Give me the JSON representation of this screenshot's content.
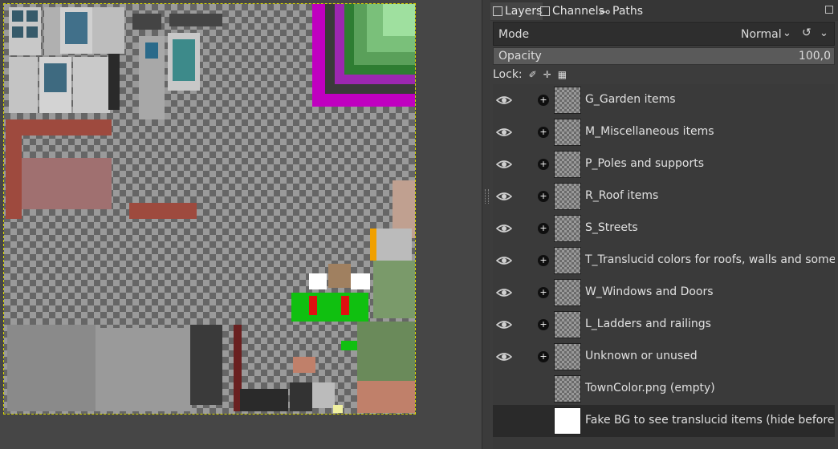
{
  "tabs": {
    "layers": "Layers",
    "channels": "Channels",
    "paths": "Paths"
  },
  "mode": {
    "label": "Mode",
    "value": "Normal"
  },
  "opacity": {
    "label": "Opacity",
    "value": "100,0"
  },
  "lock": {
    "label": "Lock:"
  },
  "layers": [
    {
      "name": "G_Garden items",
      "visible": true
    },
    {
      "name": "M_Miscellaneous items",
      "visible": true
    },
    {
      "name": "P_Poles and supports",
      "visible": true
    },
    {
      "name": "R_Roof items",
      "visible": true
    },
    {
      "name": "S_Streets",
      "visible": true
    },
    {
      "name": "T_Translucid colors for roofs, walls and sometimes f",
      "visible": true
    },
    {
      "name": "W_Windows and Doors",
      "visible": true
    },
    {
      "name": "L_Ladders and railings",
      "visible": true
    },
    {
      "name": "Unknown or unused",
      "visible": true
    },
    {
      "name": "TownColor.png (empty)",
      "visible": false
    },
    {
      "name": "Fake BG to see translucid items (hide before saving",
      "visible": false
    }
  ],
  "colors": {
    "accent": "#c000c0",
    "selected_row": "#2a2a2a"
  }
}
